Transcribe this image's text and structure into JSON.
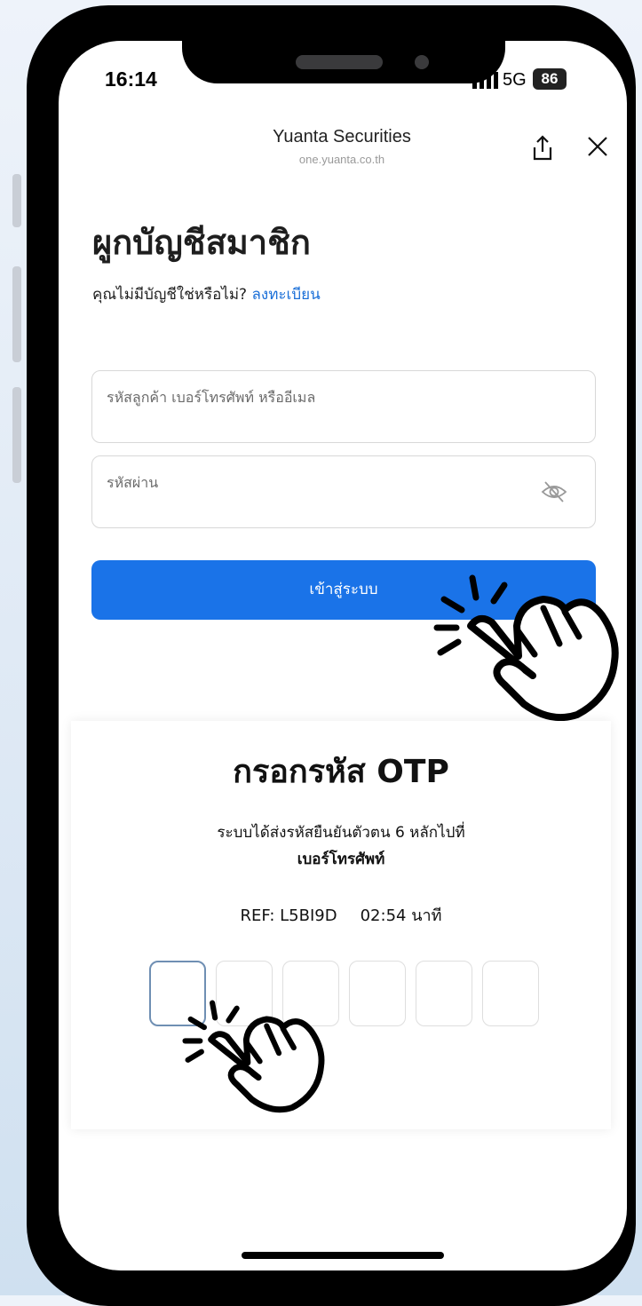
{
  "status_bar": {
    "time": "16:14",
    "network": "5G",
    "battery": "86"
  },
  "browser": {
    "title": "Yuanta Securities",
    "url": "one.yuanta.co.th"
  },
  "login": {
    "title": "ผูกบัญชีสมาชิก",
    "subtitle": "คุณไม่มีบัญชีใช่หรือไม่?",
    "register_link": "ลงทะเบียน",
    "username_placeholder": "รหัสลูกค้า เบอร์โทรศัพท์ หรืออีเมล",
    "password_placeholder": "รหัสผ่าน",
    "login_button": "เข้าสู่ระบบ"
  },
  "otp": {
    "title": "กรอกรหัส OTP",
    "description": "ระบบได้ส่งรหัสยืนยันตัวตน 6 หลักไปที่",
    "description_bold": "เบอร์โทรศัพท์",
    "ref": "REF: L5BI9D",
    "timer": "02:54 นาที",
    "digits": [
      "",
      "",
      "",
      "",
      "",
      ""
    ]
  },
  "icons": [
    "share-icon",
    "close-icon",
    "eye-off-icon",
    "tap-hand-icon"
  ],
  "colors": {
    "primary": "#1a73e8",
    "link": "#1a6fd8"
  }
}
